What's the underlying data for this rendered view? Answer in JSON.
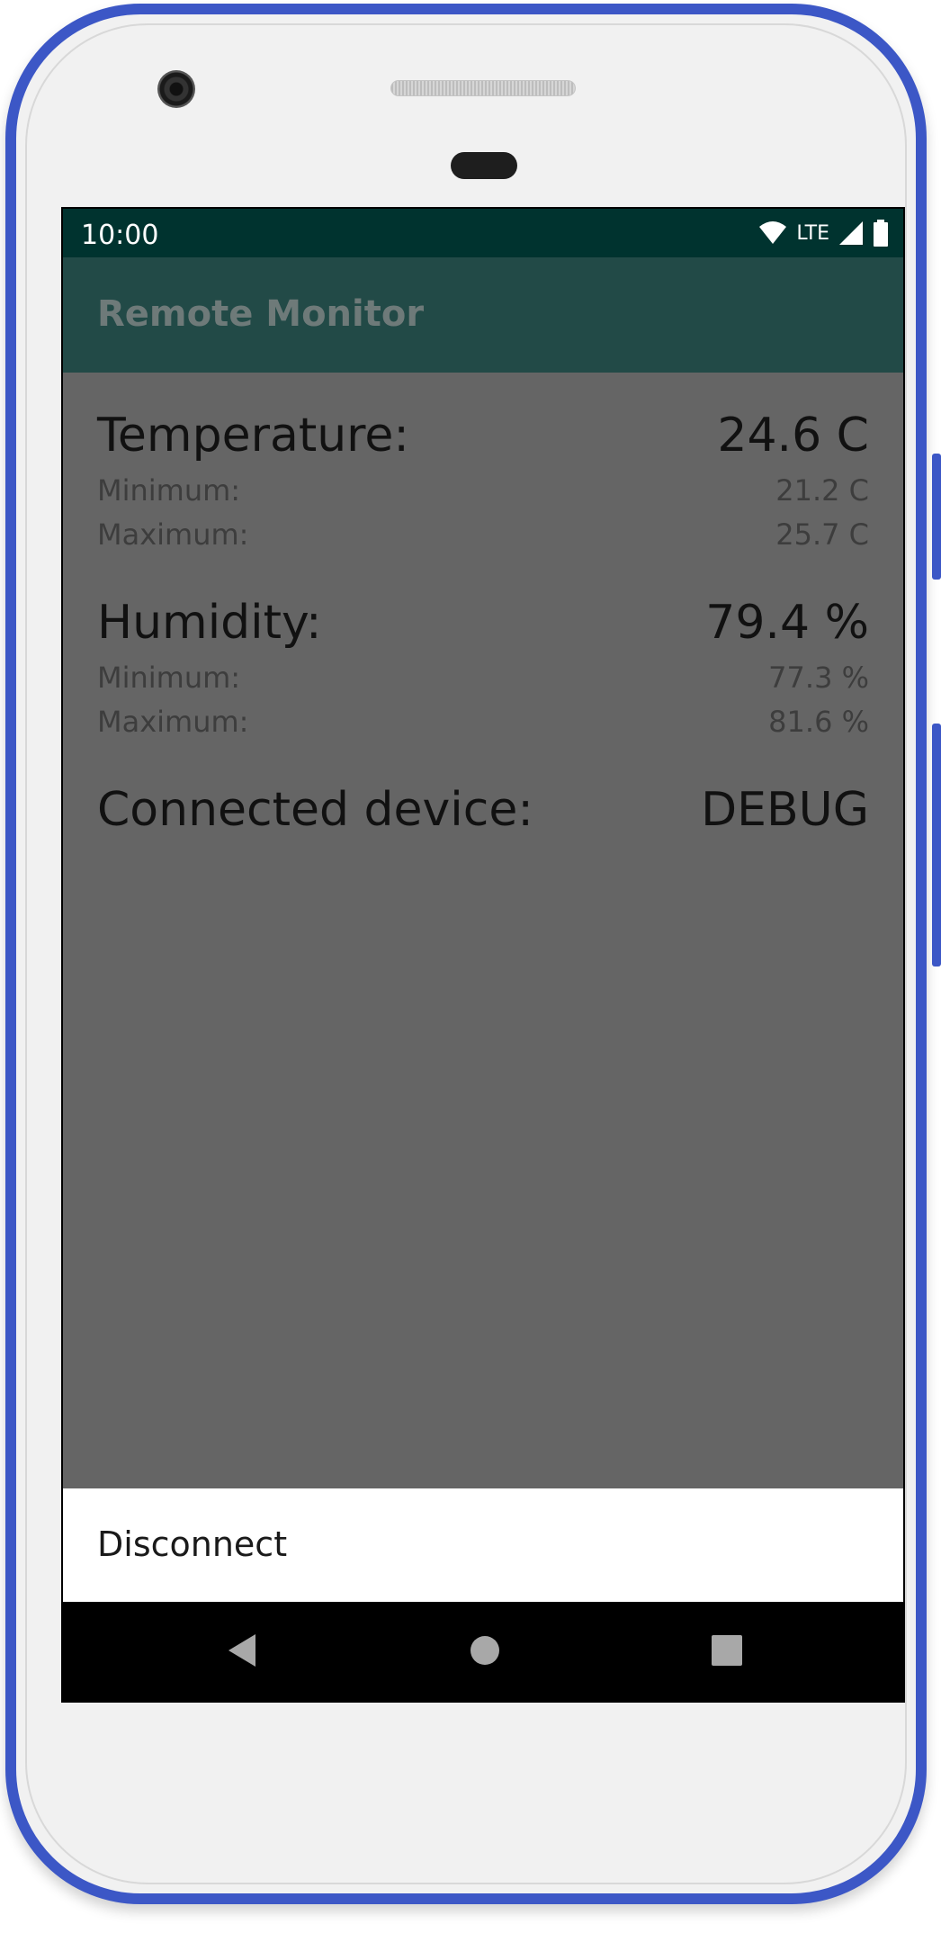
{
  "status_bar": {
    "time": "10:00",
    "network_label": "LTE",
    "icons": [
      "wifi-icon",
      "signal-icon",
      "battery-icon"
    ]
  },
  "app_bar": {
    "title": "Remote Monitor"
  },
  "readings": {
    "temperature": {
      "label": "Temperature:",
      "value": "24.6 C",
      "minimum_label": "Minimum:",
      "minimum": "21.2 C",
      "maximum_label": "Maximum:",
      "maximum": "25.7 C"
    },
    "humidity": {
      "label": "Humidity:",
      "value": "79.4 %",
      "minimum_label": "Minimum:",
      "minimum": "77.3 %",
      "maximum_label": "Maximum:",
      "maximum": "81.6 %"
    },
    "device": {
      "label": "Connected device:",
      "value": "DEBUG"
    }
  },
  "bottom_sheet": {
    "action_label": "Disconnect"
  },
  "nav_bar": {
    "buttons": [
      "back-icon",
      "home-icon",
      "recents-icon"
    ]
  },
  "colors": {
    "status_bar": "#00332f",
    "app_bar": "#224a47",
    "scrim": "#656565",
    "phone_frame": "#3c57c6"
  }
}
